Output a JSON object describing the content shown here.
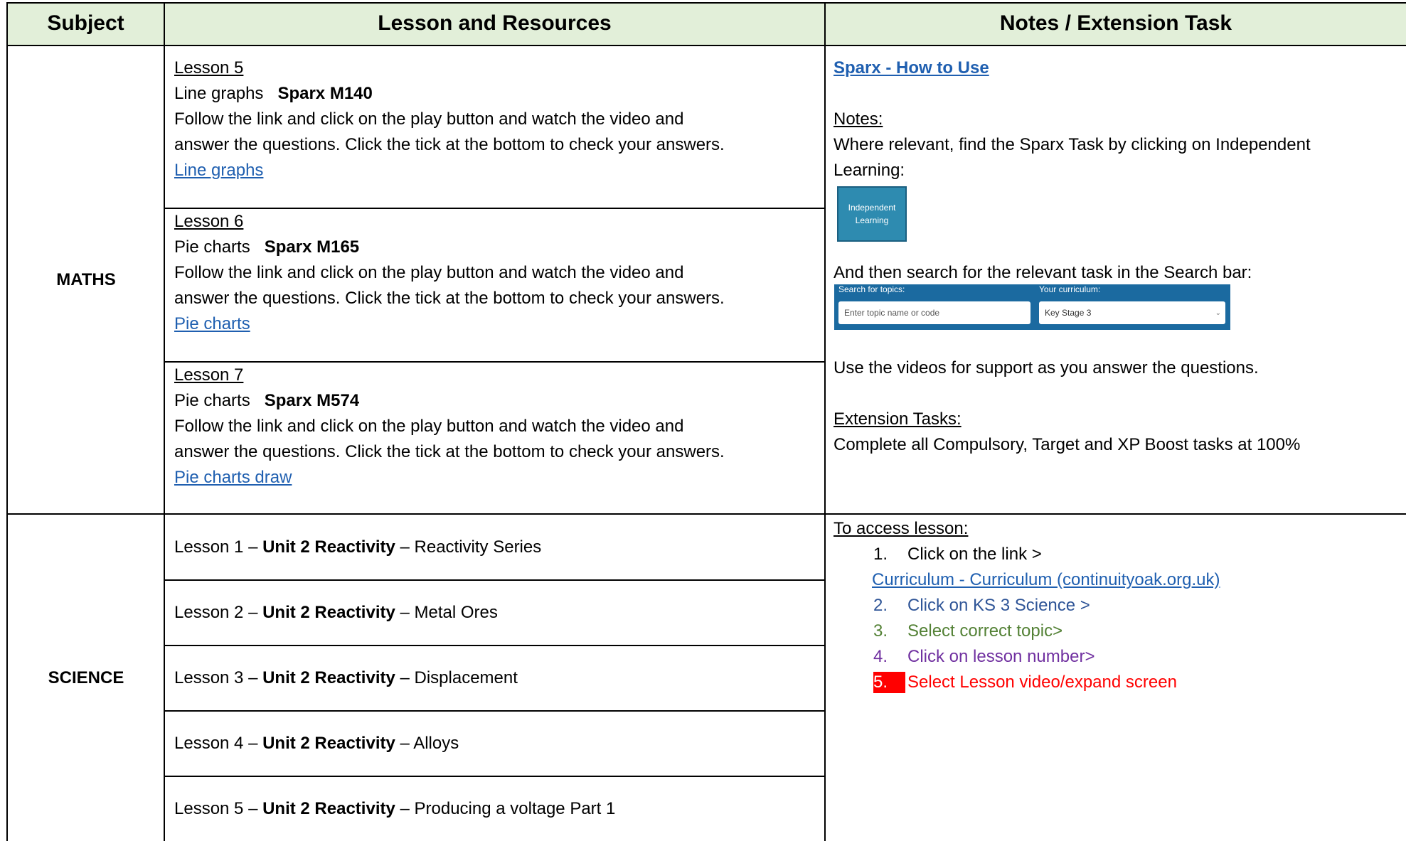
{
  "header": {
    "subject": "Subject",
    "lesson": "Lesson and Resources",
    "notes": "Notes / Extension Task"
  },
  "maths": {
    "subject": "MATHS",
    "lessons": [
      {
        "title": "Lesson 5",
        "topic": "Line graphs",
        "code": "Sparx M140",
        "line1": "Follow the link and click on the play button and watch the video and",
        "line2": "answer the questions. Click the tick at the bottom to check your answers.",
        "link": "Line graphs"
      },
      {
        "title": "Lesson 6",
        "topic": "Pie charts",
        "code": "Sparx M165",
        "line1": "Follow the link and click on the play button and watch the video and",
        "line2": "answer the questions. Click the tick at the bottom to check your answers.",
        "link": "Pie charts"
      },
      {
        "title": "Lesson 7",
        "topic": "Pie charts",
        "code": "Sparx M574",
        "line1": "Follow the link and click on the play button and watch the video and",
        "line2": "answer the questions. Click the tick at the bottom to check your answers.",
        "link": "Pie charts draw"
      }
    ],
    "notes": {
      "sparx_link": "Sparx - How to Use",
      "notes_heading": "Notes:",
      "notes_line1": "Where relevant, find the Sparx Task by clicking on Independent",
      "notes_line2": "Learning:",
      "ind_button_line1": "Independent",
      "ind_button_line2": "Learning",
      "search_intro": "And then search for the relevant task in the Search bar:",
      "search_topics_label": "Search for topics:",
      "search_placeholder": "Enter topic name or code",
      "curriculum_label": "Your curriculum:",
      "curriculum_value": "Key Stage 3",
      "videos_line": "Use the videos for support as you answer the questions.",
      "extension_heading": "Extension Tasks:",
      "extension_line": "Complete all Compulsory, Target and XP Boost tasks at 100%"
    }
  },
  "science": {
    "subject": "SCIENCE",
    "lessons": [
      {
        "prefix": "Lesson 1 – ",
        "unit": "Unit 2 Reactivity",
        "suffix": " – Reactivity Series"
      },
      {
        "prefix": "Lesson 2 – ",
        "unit": "Unit 2 Reactivity",
        "suffix": " – Metal Ores"
      },
      {
        "prefix": "Lesson 3 – ",
        "unit": "Unit 2 Reactivity",
        "suffix": " – Displacement"
      },
      {
        "prefix": "Lesson 4 – ",
        "unit": "Unit 2 Reactivity",
        "suffix": " – Alloys"
      },
      {
        "prefix": "Lesson 5 – ",
        "unit": "Unit 2 Reactivity",
        "suffix": " – Producing a voltage Part 1"
      }
    ],
    "notes": {
      "heading": "To access lesson:",
      "step1_num": "1.",
      "step1": "Click on the link >",
      "curriculum_link": "Curriculum - Curriculum (continuityoak.org.uk)",
      "step2_num": "2.",
      "step2": "Click on KS 3 Science >",
      "step3_num": "3.",
      "step3": "Select correct topic>",
      "step4_num": "4.",
      "step4": "Click on lesson number>",
      "step5_num": "5.",
      "step5": "Select Lesson video/expand screen"
    }
  },
  "colors": {
    "header_bg": "#e2efd9",
    "link": "#1f5fb0",
    "step2": "#2f5597",
    "step3": "#538135",
    "step4": "#7030a0",
    "step5": "#ff0000"
  }
}
